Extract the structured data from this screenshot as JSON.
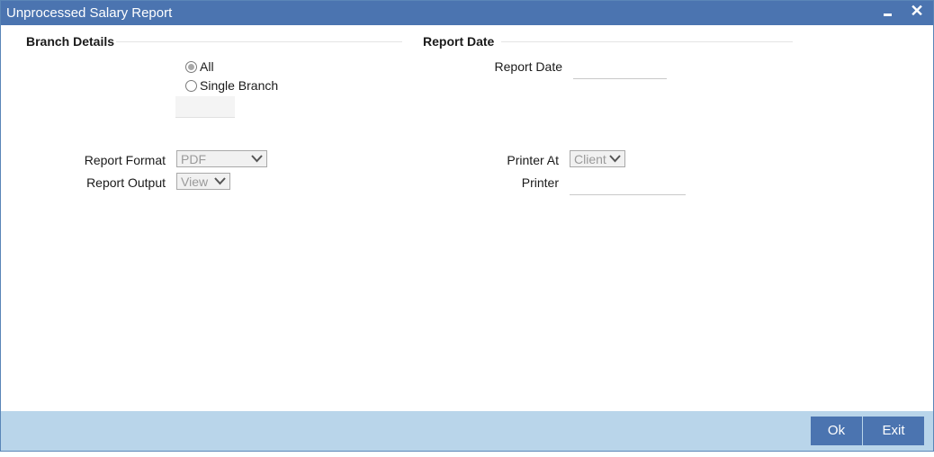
{
  "window": {
    "title": "Unprocessed Salary Report",
    "close_glyph": "✕"
  },
  "branch_details": {
    "heading": "Branch Details",
    "options": [
      {
        "label": "All",
        "selected": true
      },
      {
        "label": "Single Branch",
        "selected": false
      }
    ],
    "branch_value": ""
  },
  "report_date": {
    "heading": "Report Date",
    "label": "Report Date",
    "value": ""
  },
  "report_format": {
    "label": "Report Format",
    "value": "PDF"
  },
  "report_output": {
    "label": "Report Output",
    "value": "View"
  },
  "printer_at": {
    "label": "Printer At",
    "value": "Client"
  },
  "printer": {
    "label": "Printer",
    "value": ""
  },
  "footer": {
    "ok_label": "Ok",
    "exit_label": "Exit"
  },
  "colors": {
    "titlebar": "#4b74b0",
    "footer": "#b9d5ea",
    "button": "#4b74b0"
  },
  "icons": {
    "minimize": "minimize-icon",
    "close": "close-icon",
    "dropdown": "chevron-down-icon"
  }
}
